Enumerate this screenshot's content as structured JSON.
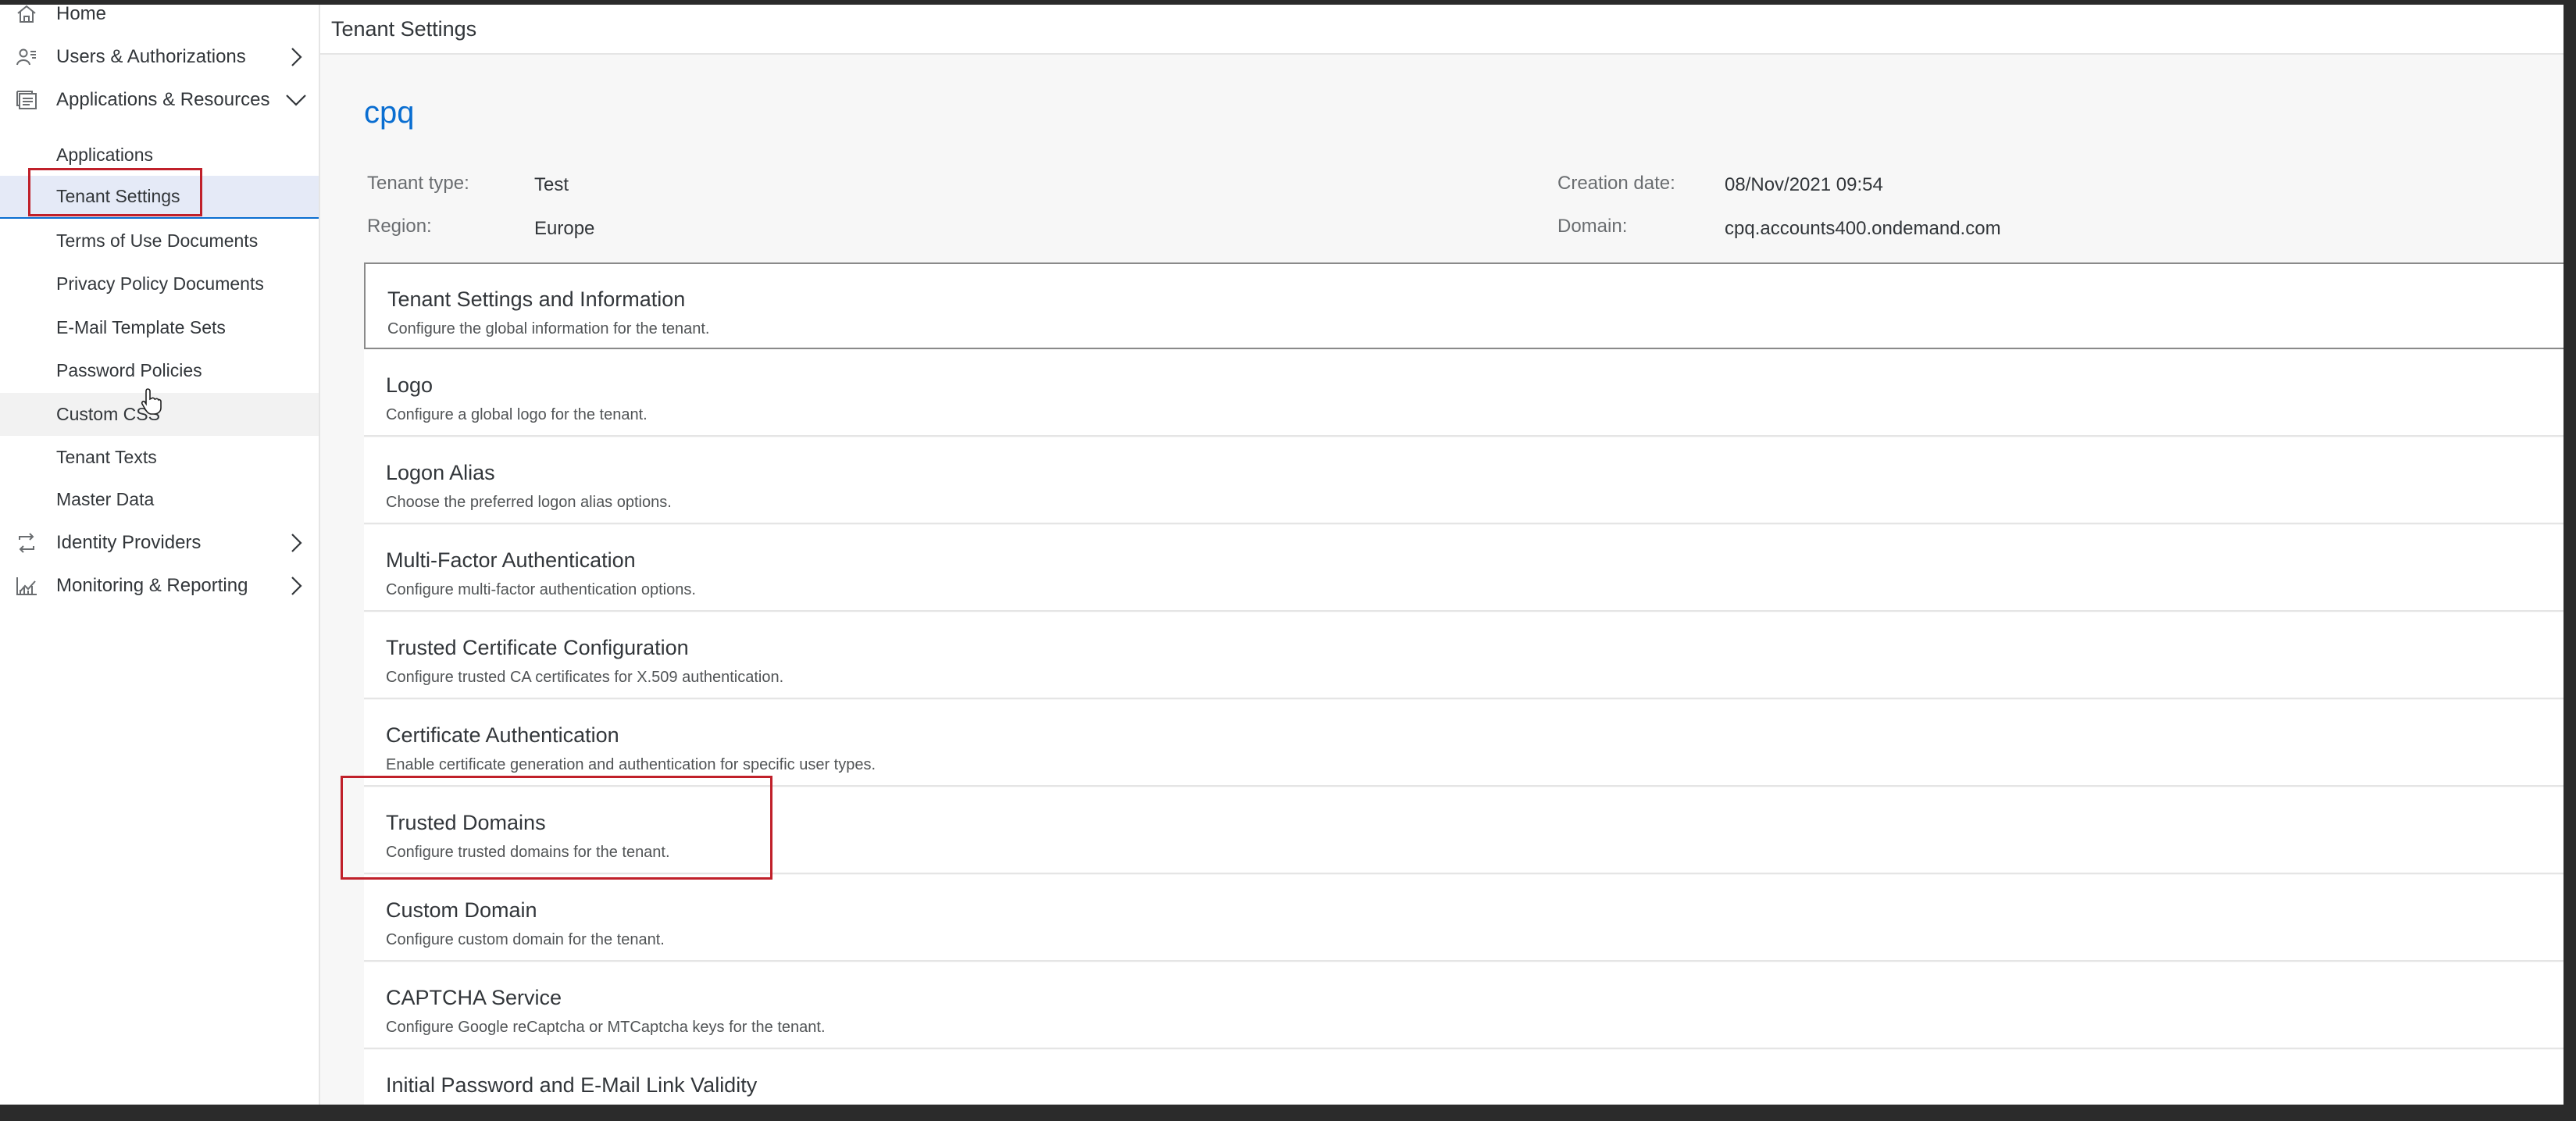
{
  "sidebar": {
    "items": [
      {
        "label": "Home",
        "icon": "home-icon"
      },
      {
        "label": "Users & Authorizations",
        "icon": "users-icon",
        "chevron": "right"
      },
      {
        "label": "Applications & Resources",
        "icon": "applications-icon",
        "chevron": "down"
      },
      {
        "label": "Identity Providers",
        "icon": "identity-providers-icon",
        "chevron": "right"
      },
      {
        "label": "Monitoring & Reporting",
        "icon": "monitoring-icon",
        "chevron": "right"
      }
    ],
    "sub_items": [
      {
        "label": "Applications"
      },
      {
        "label": "Tenant Settings",
        "selected": true
      },
      {
        "label": "Terms of Use Documents"
      },
      {
        "label": "Privacy Policy Documents"
      },
      {
        "label": "E-Mail Template Sets"
      },
      {
        "label": "Password Policies"
      },
      {
        "label": "Custom CSS",
        "hovered": true
      },
      {
        "label": "Tenant Texts"
      },
      {
        "label": "Master Data"
      }
    ]
  },
  "header": {
    "title": "Tenant Settings"
  },
  "tenant": {
    "name": "cpq",
    "type_label": "Tenant type:",
    "type_value": "Test",
    "region_label": "Region:",
    "region_value": "Europe",
    "creation_label": "Creation date:",
    "creation_value": "08/Nov/2021 09:54",
    "domain_label": "Domain:",
    "domain_value": "cpq.accounts400.ondemand.com"
  },
  "settings": [
    {
      "title": "Tenant Settings and Information",
      "description": "Configure the global information for the tenant."
    },
    {
      "title": "Logo",
      "description": "Configure a global logo for the tenant."
    },
    {
      "title": "Logon Alias",
      "description": "Choose the preferred logon alias options."
    },
    {
      "title": "Multi-Factor Authentication",
      "description": "Configure multi-factor authentication options."
    },
    {
      "title": "Trusted Certificate Configuration",
      "description": "Configure trusted CA certificates for X.509 authentication."
    },
    {
      "title": "Certificate Authentication",
      "description": "Enable certificate generation and authentication for specific user types."
    },
    {
      "title": "Trusted Domains",
      "description": "Configure trusted domains for the tenant."
    },
    {
      "title": "Custom Domain",
      "description": "Configure custom domain for the tenant."
    },
    {
      "title": "CAPTCHA Service",
      "description": "Configure Google reCaptcha or MTCaptcha keys for the tenant."
    },
    {
      "title": "Initial Password and E-Mail Link Validity",
      "description": ""
    }
  ],
  "colors": {
    "accent": "#0a6ed1",
    "highlight_box": "#c0202a",
    "selected_bg": "#e5eaf7"
  }
}
